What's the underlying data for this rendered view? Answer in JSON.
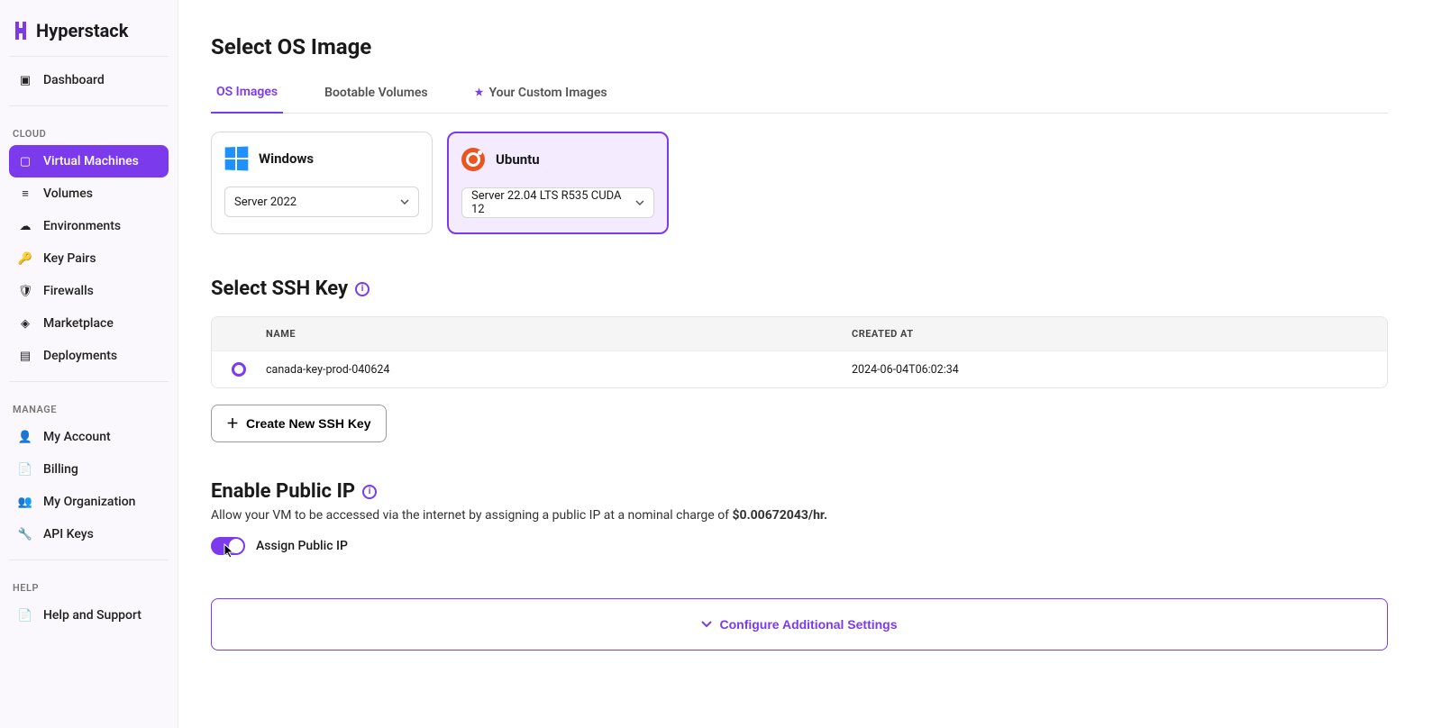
{
  "brand": "Hyperstack",
  "sidebar": {
    "top": [
      {
        "label": "Dashboard",
        "icon": "▣"
      }
    ],
    "cloud_label": "CLOUD",
    "cloud": [
      {
        "label": "Virtual Machines",
        "icon": "▢",
        "active": true
      },
      {
        "label": "Volumes",
        "icon": "≡"
      },
      {
        "label": "Environments",
        "icon": "☁"
      },
      {
        "label": "Key Pairs",
        "icon": "🔑"
      },
      {
        "label": "Firewalls",
        "icon": "🛡"
      },
      {
        "label": "Marketplace",
        "icon": "◈"
      },
      {
        "label": "Deployments",
        "icon": "▤"
      }
    ],
    "manage_label": "MANAGE",
    "manage": [
      {
        "label": "My Account",
        "icon": "👤"
      },
      {
        "label": "Billing",
        "icon": "📄"
      },
      {
        "label": "My Organization",
        "icon": "👥"
      },
      {
        "label": "API Keys",
        "icon": "🔧"
      }
    ],
    "help_label": "HELP",
    "help": [
      {
        "label": "Help and Support",
        "icon": "📄"
      }
    ]
  },
  "osImage": {
    "title": "Select OS Image",
    "tabs": [
      {
        "label": "OS Images",
        "active": true
      },
      {
        "label": "Bootable Volumes"
      },
      {
        "label": "Your Custom Images",
        "starred": true
      }
    ],
    "cards": [
      {
        "name": "Windows",
        "version": "Server 2022",
        "selected": false,
        "os": "windows"
      },
      {
        "name": "Ubuntu",
        "version": "Server 22.04 LTS R535 CUDA 12",
        "selected": true,
        "os": "ubuntu"
      }
    ]
  },
  "ssh": {
    "title": "Select SSH Key",
    "columns": {
      "name": "NAME",
      "created": "CREATED AT"
    },
    "rows": [
      {
        "name": "canada-key-prod-040624",
        "created": "2024-06-04T06:02:34"
      }
    ],
    "create_label": "Create New SSH Key"
  },
  "publicIp": {
    "title": "Enable Public IP",
    "desc_prefix": "Allow your VM to be accessed via the internet by assigning a public IP at a nominal charge of ",
    "desc_price": "$0.00672043/hr.",
    "toggle_label": "Assign Public IP",
    "toggle_on": true
  },
  "configure_label": "Configure Additional Settings"
}
